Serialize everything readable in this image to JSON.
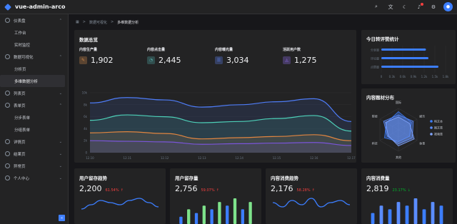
{
  "header": {
    "app_title": "vue-admin-arco",
    "avatar_text": "●"
  },
  "sidebar": {
    "groups": [
      {
        "label": "仪表盘",
        "open": true,
        "children": [
          "工作台",
          "实时监控"
        ]
      },
      {
        "label": "数据可视化",
        "open": true,
        "children": [
          "分析页",
          "多维数据分析"
        ]
      },
      {
        "label": "列表页",
        "open": false,
        "children": []
      },
      {
        "label": "表单页",
        "open": true,
        "children": [
          "分步表单",
          "分组表单"
        ]
      },
      {
        "label": "详情页",
        "open": false,
        "children": []
      },
      {
        "label": "结果页",
        "open": false,
        "children": []
      },
      {
        "label": "异常页",
        "open": false,
        "children": []
      },
      {
        "label": "个人中心",
        "open": false,
        "children": []
      }
    ],
    "active_item": "多维数据分析",
    "collapse_icon": "«"
  },
  "breadcrumb": {
    "home_icon": "home-icon",
    "items": [
      "数据可视化",
      "多维数据分析"
    ],
    "sep": ">"
  },
  "overview": {
    "title": "数据总览",
    "stats": [
      {
        "label": "内容生产量",
        "value": "1,902",
        "icon": "✎",
        "color": "#c9864a"
      },
      {
        "label": "内容点击量",
        "value": "2,445",
        "icon": "◔",
        "color": "#4fa3a0"
      },
      {
        "label": "内容曝光量",
        "value": "3,034",
        "icon": "☰",
        "color": "#5a7be0"
      },
      {
        "label": "活跃用户数",
        "value": "1,275",
        "icon": "◬",
        "color": "#8b6ae0"
      }
    ]
  },
  "chart_data": [
    {
      "type": "area",
      "x": [
        "12.10",
        "12.11",
        "12.12",
        "12.13",
        "12.14",
        "12.15",
        "12.16",
        "12.17"
      ],
      "y_ticks": [
        "0",
        "2k",
        "4k",
        "6k",
        "8k",
        "10k"
      ],
      "ylim": [
        0,
        10000
      ],
      "series": [
        {
          "color": "#4e7cf6",
          "values": [
            8300,
            9200,
            8800,
            7600,
            8000,
            8500,
            9000,
            5200
          ]
        },
        {
          "color": "#4dd0b8",
          "values": [
            5400,
            6300,
            6000,
            5000,
            5200,
            5700,
            6200,
            3600
          ]
        },
        {
          "color": "#e08540",
          "values": [
            3300,
            3500,
            3200,
            2300,
            2500,
            2700,
            3000,
            2000
          ]
        },
        {
          "color": "#7a55d9",
          "values": [
            2000,
            1900,
            1800,
            1400,
            1500,
            1600,
            1700,
            1200
          ]
        }
      ]
    },
    {
      "type": "bar",
      "title": "今日转评赞统计",
      "x_ticks": [
        "0",
        "0.3k",
        "0.6k",
        "0.9k",
        "1.2k",
        "1.5k",
        "1.8k"
      ],
      "categories": [
        "分享量",
        "评论量",
        "点赞量"
      ],
      "values": [
        1250,
        1320,
        1600
      ],
      "xlim": [
        0,
        1800
      ]
    },
    {
      "type": "radar",
      "title": "内容题材分布",
      "axes": [
        "国际",
        "娱乐",
        "体育",
        "其他",
        "科技",
        "财经"
      ],
      "legend": [
        "纯文本",
        "图文类",
        "视频类"
      ],
      "series": [
        {
          "name": "纯文本",
          "values": [
            0.85,
            0.7,
            0.6,
            0.55,
            0.75,
            0.65
          ],
          "color": "#3c7eff"
        },
        {
          "name": "图文类",
          "values": [
            0.7,
            0.8,
            0.75,
            0.65,
            0.6,
            0.8
          ],
          "color": "#5b8dff"
        },
        {
          "name": "视频类",
          "values": [
            0.6,
            0.6,
            0.85,
            0.75,
            0.55,
            0.7
          ],
          "color": "#82a6ff"
        }
      ]
    },
    {
      "type": "line",
      "title": "用户留存趋势",
      "value": "2,200",
      "pct": "61.54%",
      "trend": "↑",
      "values": [
        3,
        5,
        7,
        6,
        5,
        7,
        8,
        6,
        4
      ]
    },
    {
      "type": "bar",
      "title": "用户留存量",
      "value": "2,756",
      "pct": "59.07%",
      "trend": "↑",
      "values": [
        2,
        4,
        3,
        5,
        4,
        6,
        5,
        7,
        4,
        6
      ]
    },
    {
      "type": "line",
      "title": "内容消费趋势",
      "value": "2,176",
      "pct": "58.28%",
      "trend": "↑",
      "values": [
        6,
        4,
        7,
        5,
        8,
        4,
        6,
        7,
        5
      ]
    },
    {
      "type": "bar",
      "title": "内容消费量",
      "value": "2,819",
      "pct": "23.17%",
      "trend": "↓",
      "values": [
        3,
        5,
        4,
        6,
        5,
        7,
        4,
        6,
        5
      ]
    }
  ],
  "colors": {
    "up": "#f53f3f",
    "down": "#00b42a",
    "green_bar": "#7ee38b",
    "blue_bar": "#3c7eff"
  }
}
